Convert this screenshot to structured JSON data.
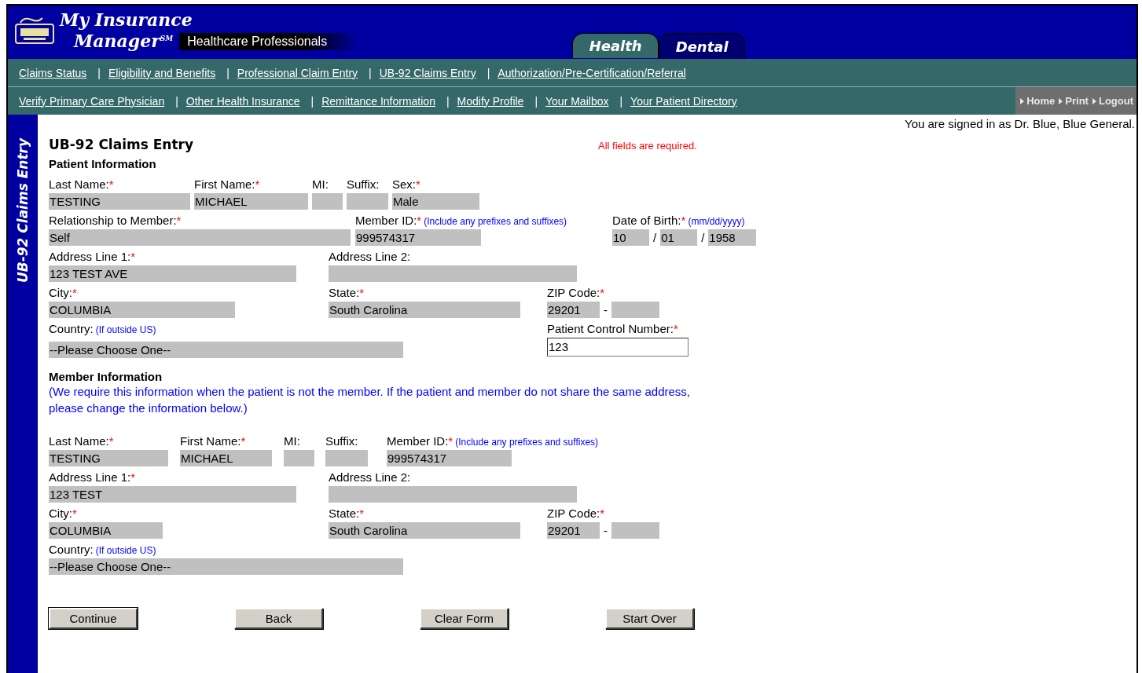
{
  "header": {
    "logo_line1": "My Insurance",
    "logo_line2": "Manager$^{SM}$",
    "subtitle": "Healthcare Professionals"
  },
  "tabs": [
    {
      "label": "Health",
      "selected": true
    },
    {
      "label": "Dental",
      "selected": false
    }
  ],
  "nav": {
    "separator": "|",
    "rows": [
      [
        "Claims Status",
        "Eligibility and Benefits",
        "Professional Claim Entry",
        "UB-92 Claims Entry",
        "Authorization/Pre-Certification/Referral"
      ],
      [
        "Verify Primary Care Physician",
        "Other Health Insurance",
        "Remittance Information",
        "Modify Profile",
        "Your Mailbox",
        "Your Patient Directory"
      ]
    ]
  },
  "utility_links": [
    "Home",
    "Print",
    "Logout"
  ],
  "signed_in": "You are signed in as Dr. Blue, Blue General.",
  "sidebar_title": "UB-92 Claims Entry",
  "page_title": "UB-92 Claims Entry",
  "required_note": "All fields are required.",
  "required_mark": "*",
  "patient": {
    "heading": "Patient Information",
    "last_name": {
      "label": "Last Name:",
      "required": true,
      "value": "TESTING"
    },
    "first_name": {
      "label": "First Name:",
      "required": true,
      "value": "MICHAEL"
    },
    "mi": {
      "label": "MI:",
      "required": false
    },
    "suffix": {
      "label": "Suffix:",
      "required": false
    },
    "sex": {
      "label": "Sex:",
      "required": true,
      "value": "Male"
    },
    "relationship": {
      "label": "Relationship to Member:",
      "required": true,
      "value": "Self"
    },
    "member_id": {
      "label": "Member ID:",
      "required": true,
      "hint": "(Include any prefixes and suffixes)",
      "value": "999574317"
    },
    "dob": {
      "label": "Date of Birth:",
      "required": true,
      "hint": "(mm/dd/yyyy)",
      "parts": [
        "10",
        "01",
        "1958"
      ],
      "separator": "/"
    },
    "address1": {
      "label": "Address Line 1:",
      "required": true,
      "value": "123 TEST AVE"
    },
    "address2": {
      "label": "Address Line 2:",
      "required": false
    },
    "city": {
      "label": "City:",
      "required": true,
      "value": "COLUMBIA"
    },
    "state": {
      "label": "State:",
      "required": true,
      "value": "South Carolina"
    },
    "zip": {
      "label": "ZIP Code:",
      "required": true,
      "value": "29201",
      "separator": "-"
    },
    "country": {
      "label": "Country:",
      "required": false,
      "hint": "(If outside US)",
      "value": "--Please Choose One--"
    },
    "control_number": {
      "label": "Patient Control Number:",
      "required": true,
      "value": "123"
    }
  },
  "member": {
    "heading": "Member Information",
    "note": "(We require this information when the patient is not the member. If the patient and member do not share the same address, please change the information below.)",
    "last_name": {
      "label": "Last Name:",
      "required": true,
      "value": "TESTING"
    },
    "first_name": {
      "label": "First Name:",
      "required": true,
      "value": "MICHAEL"
    },
    "mi": {
      "label": "MI:",
      "required": false
    },
    "suffix": {
      "label": "Suffix:",
      "required": false
    },
    "member_id": {
      "label": "Member ID:",
      "required": true,
      "hint": "(Include any prefixes and suffixes)",
      "value": "999574317"
    },
    "address1": {
      "label": "Address Line 1:",
      "required": true,
      "value": "123 TEST"
    },
    "address2": {
      "label": "Address Line 2:",
      "required": false
    },
    "city": {
      "label": "City:",
      "required": true,
      "value": "COLUMBIA"
    },
    "state": {
      "label": "State:",
      "required": true,
      "value": "South Carolina"
    },
    "zip": {
      "label": "ZIP Code:",
      "required": true,
      "value": "29201",
      "separator": "-"
    },
    "country": {
      "label": "Country:",
      "required": false,
      "hint": "(If outside US)",
      "value": "--Please Choose One--"
    }
  },
  "buttons": [
    "Continue",
    "Back",
    "Clear Form",
    "Start Over"
  ]
}
